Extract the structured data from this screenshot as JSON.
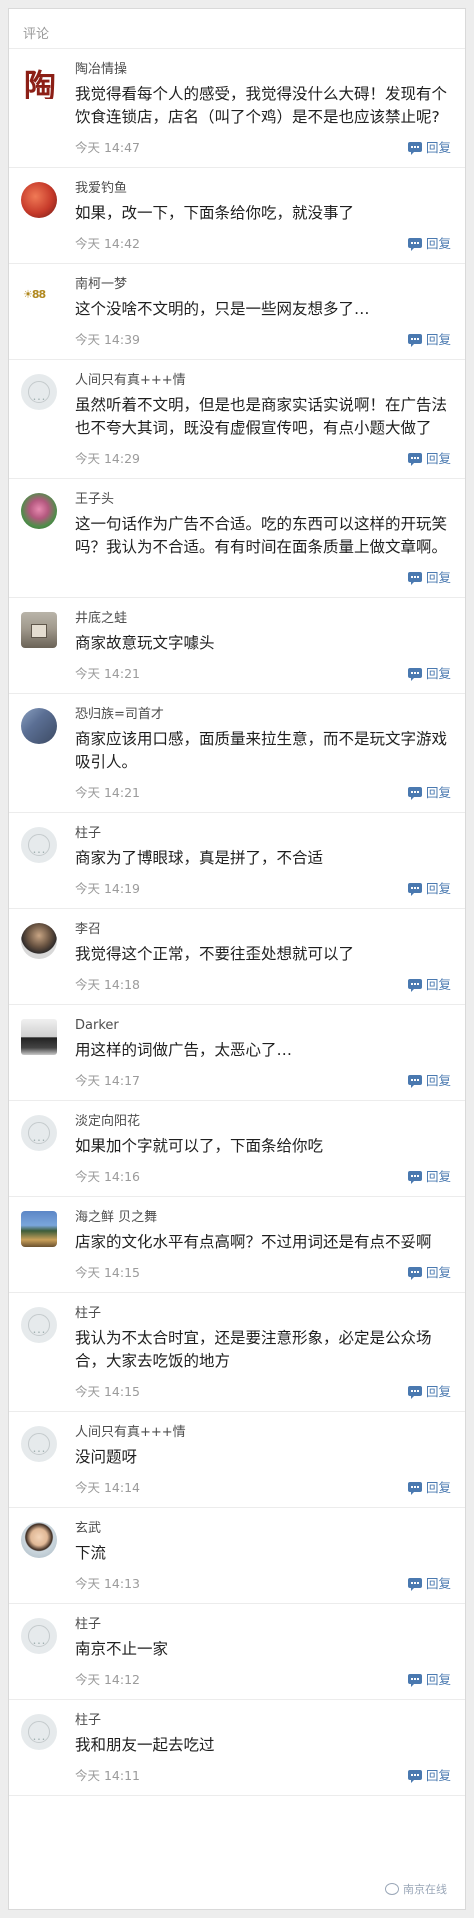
{
  "header": {
    "title": "评论"
  },
  "reply_label": "回复",
  "watermark": "南京在线",
  "comments": [
    {
      "avatar": "brush-calligraphy-avatar",
      "name": "陶冶情操",
      "text": "我觉得看每个人的感受，我觉得没什么大碍！发现有个饮食连锁店，店名（叫了个鸡）是不是也应该禁止呢?",
      "time": "今天 14:47"
    },
    {
      "avatar": "red-photo-avatar",
      "name": "我爱钓鱼",
      "text": "如果，改一下，下面条给你吃，就没事了",
      "time": "今天 14:42"
    },
    {
      "avatar": "gold-logo-avatar",
      "name": "南柯一梦",
      "text": "这个没啥不文明的，只是一些网友想多了…",
      "time": "今天 14:39"
    },
    {
      "avatar": "default-avatar",
      "name": "人间只有真+++情",
      "text": "虽然听着不文明，但是也是商家实话实说啊！在广告法也不夸大其词，既没有虚假宣传吧，有点小题大做了",
      "time": "今天 14:29"
    },
    {
      "avatar": "lotus-avatar",
      "name": "王子头",
      "text": "这一句话作为广告不合适。吃的东西可以这样的开玩笑吗？我认为不合适。有有时间在面条质量上做文章啊。",
      "time": ""
    },
    {
      "avatar": "house-avatar",
      "name": "井底之蛙",
      "text": "商家故意玩文字噱头",
      "time": "今天 14:21"
    },
    {
      "avatar": "blossom-avatar",
      "name": "恐归族=司首才",
      "text": "商家应该用口感，面质量来拉生意，而不是玩文字游戏吸引人。",
      "time": "今天 14:21"
    },
    {
      "avatar": "default-avatar",
      "name": "柱子",
      "text": "商家为了博眼球，真是拼了，不合适",
      "time": "今天 14:19"
    },
    {
      "avatar": "man-avatar",
      "name": "李召",
      "text": "我觉得这个正常，不要往歪处想就可以了",
      "time": "今天 14:18"
    },
    {
      "avatar": "car-avatar",
      "name": "Darker",
      "text": "用这样的词做广告，太恶心了…",
      "time": "今天 14:17"
    },
    {
      "avatar": "default-avatar",
      "name": "淡定向阳花",
      "text": "如果加个字就可以了，下面条给你吃",
      "time": "今天 14:16"
    },
    {
      "avatar": "lake-avatar",
      "name": "海之鲜 贝之舞",
      "text": "店家的文化水平有点高啊？不过用词还是有点不妥啊",
      "time": "今天 14:15"
    },
    {
      "avatar": "default-avatar",
      "name": "柱子",
      "text": "我认为不太合时宜，还是要注意形象，必定是公众场合，大家去吃饭的地方",
      "time": "今天 14:15"
    },
    {
      "avatar": "default-avatar",
      "name": "人间只有真+++情",
      "text": "没问题呀",
      "time": "今天 14:14"
    },
    {
      "avatar": "boy-avatar",
      "name": "玄武",
      "text": "下流",
      "time": "今天 14:13"
    },
    {
      "avatar": "default-avatar",
      "name": "柱子",
      "text": "南京不止一家",
      "time": "今天 14:12"
    },
    {
      "avatar": "default-avatar",
      "name": "柱子",
      "text": "我和朋友一起去吃过",
      "time": "今天 14:11"
    }
  ]
}
